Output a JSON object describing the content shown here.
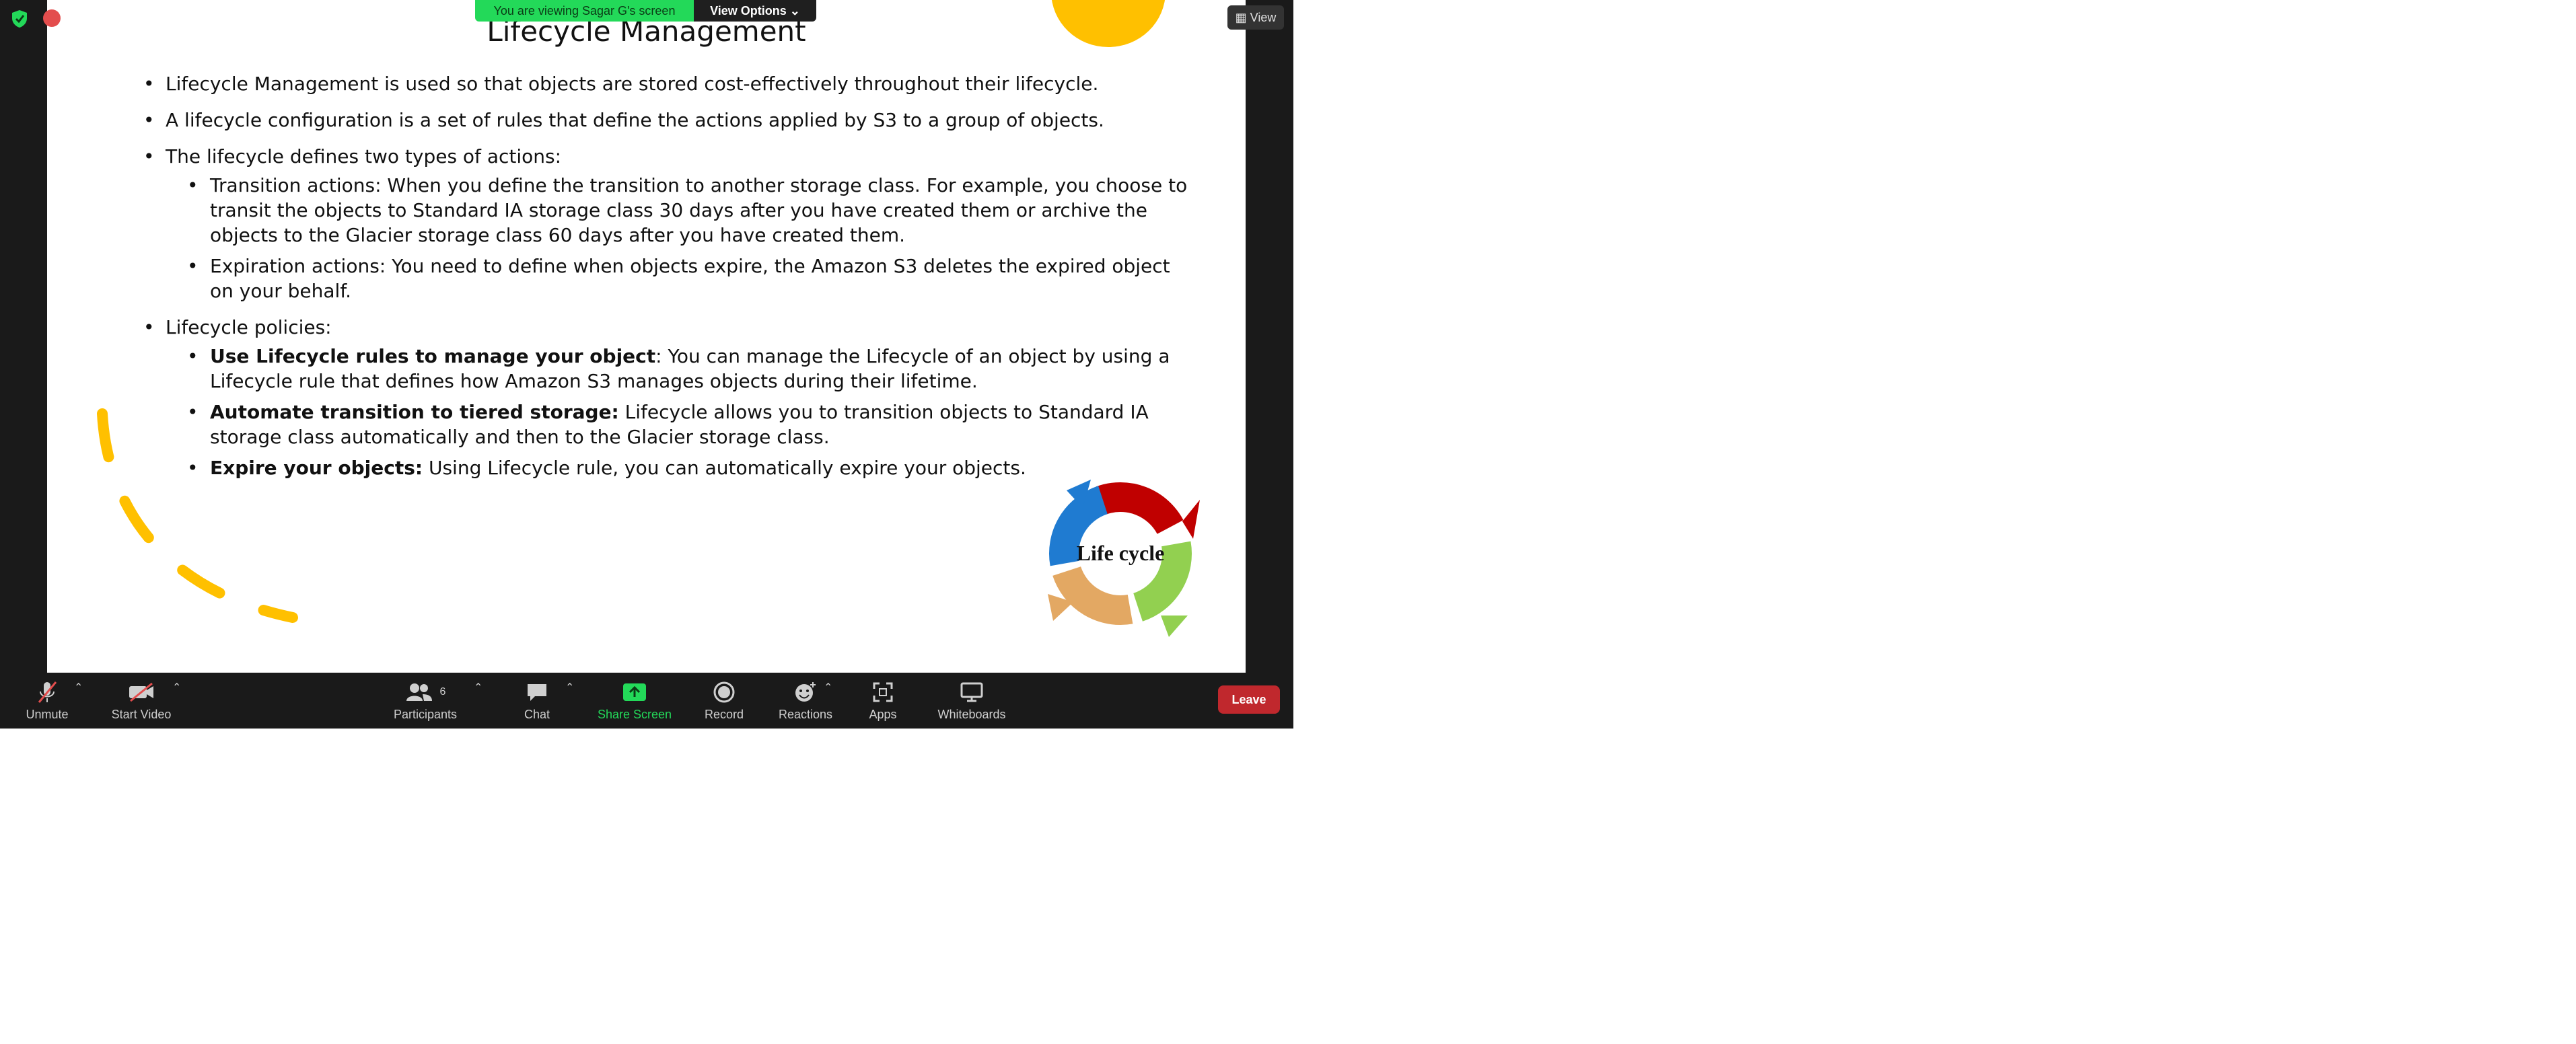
{
  "share_banner": {
    "message": "You are viewing Sagar G's screen",
    "view_options": "View Options ⌄"
  },
  "top_right": {
    "view_label": "View"
  },
  "slide": {
    "title": "Lifecycle Management",
    "bullets": {
      "b1": "Lifecycle Management is used so that objects are stored cost-effectively throughout their lifecycle.",
      "b2": "A lifecycle configuration is a set of rules that define the actions applied by S3 to a group of objects.",
      "b3": "The lifecycle defines two types of actions:",
      "b3_sub1": "Transition actions: When you define the transition to another storage class. For example, you choose to transit the objects to Standard IA storage class 30 days after you have created them or archive the objects to the Glacier storage class 60 days after you have created them.",
      "b3_sub2": "Expiration actions: You need to define when objects expire, the Amazon S3 deletes the expired object on your behalf.",
      "b4": "Lifecycle policies:",
      "b4_sub1_bold": "Use Lifecycle rules to manage your object",
      "b4_sub1_text": ": You can manage the Lifecycle of an object by using a Lifecycle rule that defines how Amazon S3 manages objects during their lifetime.",
      "b4_sub2_bold": "Automate transition to tiered storage:",
      "b4_sub2_text": " Lifecycle allows you to transition objects to Standard IA storage class automatically and then to the Glacier storage class.",
      "b4_sub3_bold": "Expire your objects:",
      "b4_sub3_text": " Using Lifecycle rule, you can automatically expire your objects."
    },
    "cycle_label": "Life cycle"
  },
  "toolbar": {
    "unmute": "Unmute",
    "start_video": "Start Video",
    "participants": "Participants",
    "participants_count": "6",
    "chat": "Chat",
    "share_screen": "Share Screen",
    "record": "Record",
    "reactions": "Reactions",
    "apps": "Apps",
    "whiteboards": "Whiteboards",
    "leave": "Leave"
  },
  "colors": {
    "share_green": "#23d959",
    "leave_red": "#c0282d",
    "deco_yellow": "#ffc000"
  }
}
